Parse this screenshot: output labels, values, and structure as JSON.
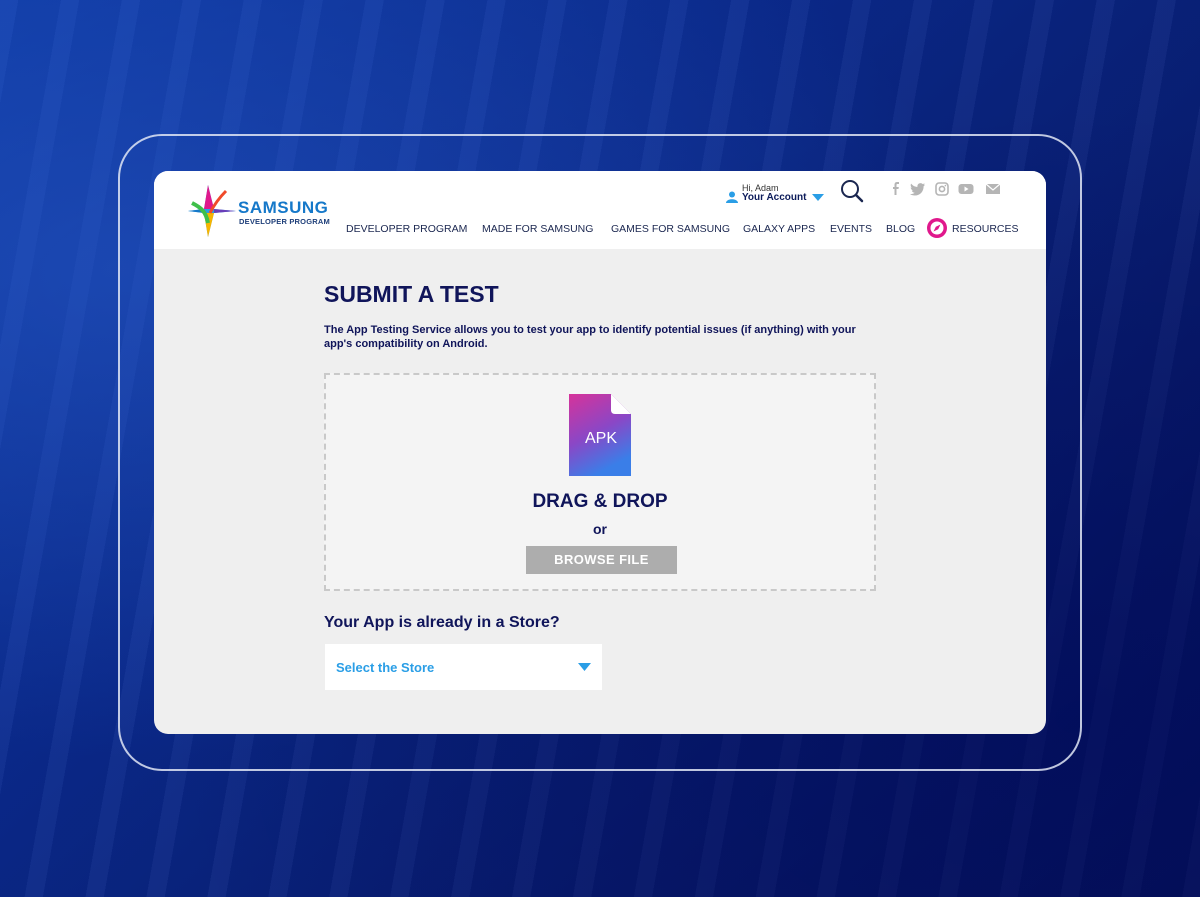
{
  "brand": {
    "name": "SAMSUNG",
    "subtitle": "DEVELOPER PROGRAM"
  },
  "account": {
    "greeting": "Hi, Adam",
    "label": "Your Account"
  },
  "nav": {
    "items": [
      "DEVELOPER PROGRAM",
      "MADE FOR SAMSUNG",
      "GAMES FOR SAMSUNG",
      "GALAXY APPS",
      "EVENTS",
      "BLOG",
      "RESOURCES"
    ]
  },
  "social_icons": [
    "facebook-icon",
    "twitter-icon",
    "instagram-icon",
    "youtube-icon",
    "mail-icon"
  ],
  "main": {
    "title": "SUBMIT A TEST",
    "description": "The App Testing Service allows you to test your app to identify potential issues (if anything) with your app's compatibility on Android."
  },
  "upload": {
    "file_icon_label": "APK",
    "drag_text": "DRAG & DROP",
    "or_text": "or",
    "browse_label": "BROWSE FILE"
  },
  "store": {
    "question": "Your App is already in a Store?",
    "select_placeholder": "Select the Store"
  },
  "colors": {
    "navy": "#10155a",
    "brand_blue": "#1578c9",
    "link_blue": "#2a9ee6",
    "accent_magenta": "#e0188c",
    "button_gray": "#adadad"
  }
}
